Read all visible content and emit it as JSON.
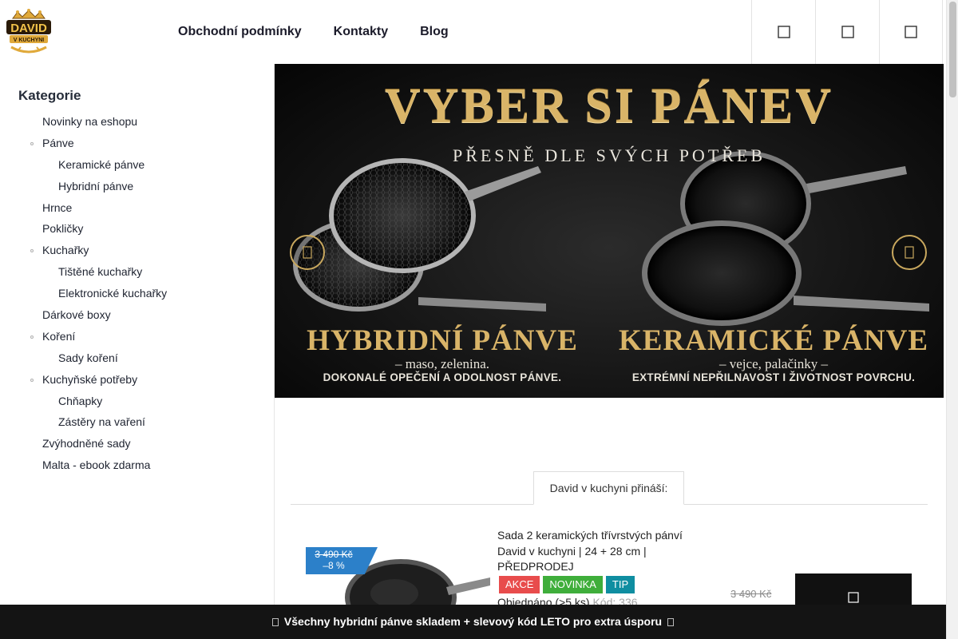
{
  "header": {
    "logo_top": "DAVID",
    "logo_bottom": "V KUCHYNI",
    "nav": [
      {
        "label": "Obchodní podmínky"
      },
      {
        "label": "Kontakty"
      },
      {
        "label": "Blog"
      }
    ],
    "icons": [
      "search-icon",
      "user-icon",
      "cart-icon"
    ]
  },
  "sidebar": {
    "title": "Kategorie",
    "items": [
      {
        "label": "Novinky na eshopu",
        "level": 1,
        "has_children": false
      },
      {
        "label": "Pánve",
        "level": 1,
        "has_children": true
      },
      {
        "label": "Keramické pánve",
        "level": 2,
        "has_children": false
      },
      {
        "label": "Hybridní pánve",
        "level": 2,
        "has_children": false
      },
      {
        "label": "Hrnce",
        "level": 1,
        "has_children": false
      },
      {
        "label": "Pokličky",
        "level": 1,
        "has_children": false
      },
      {
        "label": "Kuchařky",
        "level": 1,
        "has_children": true
      },
      {
        "label": "Tištěné kuchařky",
        "level": 2,
        "has_children": false
      },
      {
        "label": "Elektronické kuchařky",
        "level": 2,
        "has_children": false
      },
      {
        "label": "Dárkové boxy",
        "level": 1,
        "has_children": false
      },
      {
        "label": "Koření",
        "level": 1,
        "has_children": true
      },
      {
        "label": "Sady koření",
        "level": 2,
        "has_children": false
      },
      {
        "label": "Kuchyňské potřeby",
        "level": 1,
        "has_children": true
      },
      {
        "label": "Chňapky",
        "level": 2,
        "has_children": false
      },
      {
        "label": "Zástěry na vaření",
        "level": 2,
        "has_children": false
      },
      {
        "label": "Zvýhodněné sady",
        "level": 1,
        "has_children": false
      },
      {
        "label": "Malta - ebook zdarma",
        "level": 1,
        "has_children": false
      }
    ]
  },
  "banner": {
    "title": "VYBER SI PÁNEV",
    "subtitle": "PŘESNĚ DLE SVÝCH POTŘEB",
    "left_label": "HYBRIDNÍ PÁNVE",
    "left_small": "– maso, zelenina.",
    "left_tag": "DOKONALÉ OPEČENÍ A ODOLNOST PÁNVE.",
    "right_label": "KERAMICKÉ PÁNVE",
    "right_small": "– vejce, palačinky –",
    "right_tag": "EXTRÉMNÍ NEPŘILNAVOST I ŽIVOTNOST POVRCHU.",
    "colors": {
      "gold": "#d9b468",
      "background": "#151515"
    }
  },
  "tabs": {
    "active": "David v kuchyni přináší:"
  },
  "product": {
    "flag_old_price": "3 490 Kč",
    "flag_discount": "–8 %",
    "name": "Sada 2 keramických třívrstvých pánví David v kuchyni | 24 + 28 cm | PŘEDPRODEJ",
    "badges": [
      {
        "label": "AKCE",
        "color": "#e84c4c"
      },
      {
        "label": "NOVINKA",
        "color": "#3fae3b"
      },
      {
        "label": "TIP",
        "color": "#0f8ea1"
      }
    ],
    "availability": "Objednáno (>5 ks)",
    "code": "Kód: 336",
    "old_price": "3 490 Kč"
  },
  "promo_bar": {
    "text": "Všechny hybridní pánve skladem + slevový kód LETO pro extra úsporu"
  }
}
